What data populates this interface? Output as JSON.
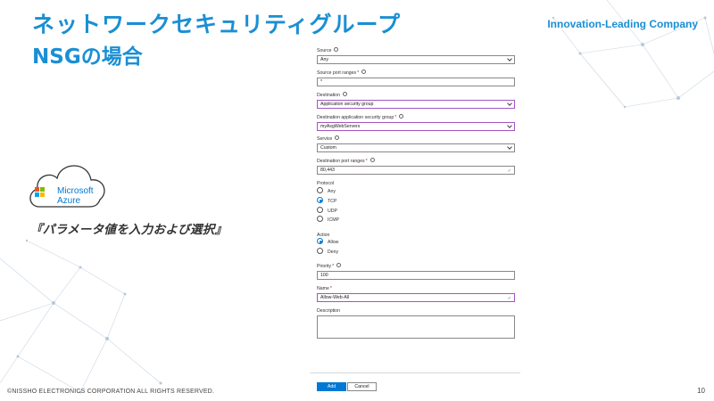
{
  "title_line1": "ネットワークセキュリティグループ",
  "title_line2": "NSGの場合",
  "tagline": "Innovation-Leading Company",
  "azure_logo": {
    "line1": "Microsoft",
    "line2": "Azure"
  },
  "caption": "『パラメータ値を入力および選択』",
  "footer": "©NISSHO  ELECTRONICS  CORPORATION  ALL RIGHTS  RESERVED.",
  "page_number": "10",
  "form": {
    "source": {
      "label": "Source",
      "value": "Any"
    },
    "source_port_ranges": {
      "label": "Source port ranges",
      "value": "*"
    },
    "destination": {
      "label": "Destination",
      "value": "Application security group"
    },
    "destination_asg": {
      "label": "Destination application security group",
      "value": "myAsgWebServers"
    },
    "service": {
      "label": "Service",
      "value": "Custom"
    },
    "destination_port_ranges": {
      "label": "Destination port ranges",
      "value": "80,443"
    },
    "protocol": {
      "label": "Protocol",
      "options": [
        "Any",
        "TCP",
        "UDP",
        "ICMP"
      ],
      "selected": "TCP"
    },
    "action": {
      "label": "Action",
      "options": [
        "Allow",
        "Deny"
      ],
      "selected": "Allow"
    },
    "priority": {
      "label": "Priority",
      "value": "100"
    },
    "name": {
      "label": "Name",
      "value": "Allow-Web-All"
    },
    "description": {
      "label": "Description",
      "value": ""
    },
    "add_label": "Add",
    "cancel_label": "Cancel"
  },
  "colors": {
    "title": "#1a8fd4",
    "azure_blue": "#0078d4",
    "focus_purple": "#a552c4",
    "azure_logo": [
      "#f25022",
      "#7fba00",
      "#00a4ef",
      "#ffb900"
    ]
  }
}
